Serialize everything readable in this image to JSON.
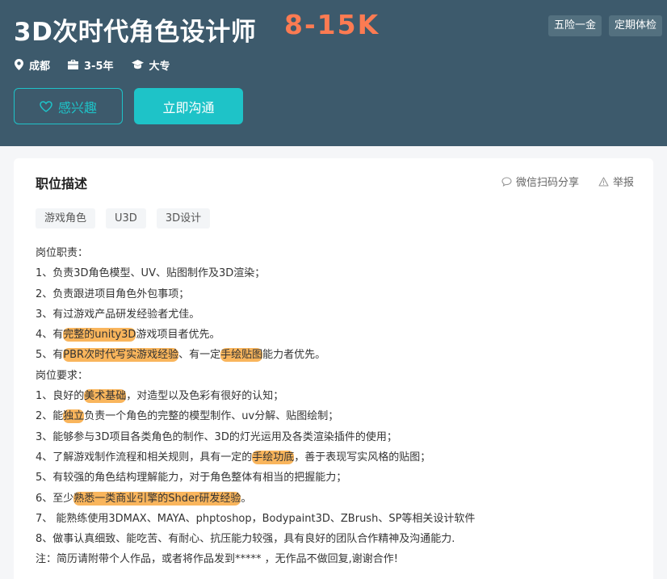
{
  "job": {
    "title": "3D次时代角色设计师",
    "salary": "8-15K",
    "benefits": [
      "五险一金",
      "定期体检"
    ],
    "meta": {
      "city": "成都",
      "experience": "3-5年",
      "education": "大专"
    }
  },
  "actions": {
    "interest_label": "感兴趣",
    "chat_label": "立即沟通"
  },
  "description": {
    "section_title": "职位描述",
    "share_label": "微信扫码分享",
    "report_label": "举报",
    "tags": [
      "游戏角色",
      "U3D",
      "3D设计"
    ],
    "lines": [
      {
        "segments": [
          {
            "text": "岗位职责：",
            "hl": false
          }
        ]
      },
      {
        "segments": [
          {
            "text": "1、负责3D角色模型、UV、贴图制作及3D渲染；",
            "hl": false
          }
        ]
      },
      {
        "segments": [
          {
            "text": "2、负责跟进项目角色外包事项；",
            "hl": false
          }
        ]
      },
      {
        "segments": [
          {
            "text": "3、有过游戏产品研发经验者尤佳。",
            "hl": false
          }
        ]
      },
      {
        "segments": [
          {
            "text": "4、有",
            "hl": false
          },
          {
            "text": "完整的unity3D",
            "hl": true
          },
          {
            "text": "游戏项目者优先。",
            "hl": false
          }
        ]
      },
      {
        "segments": [
          {
            "text": "5、有",
            "hl": false
          },
          {
            "text": "PBR次时代写实游戏经验",
            "hl": true
          },
          {
            "text": "、有一定",
            "hl": false
          },
          {
            "text": "手绘贴图",
            "hl": true
          },
          {
            "text": "能力者优先。",
            "hl": false
          }
        ]
      },
      {
        "segments": [
          {
            "text": "岗位要求：",
            "hl": false
          }
        ]
      },
      {
        "segments": [
          {
            "text": "1、良好的",
            "hl": false
          },
          {
            "text": "美术基础",
            "hl": true
          },
          {
            "text": "，对造型以及色彩有很好的认知；",
            "hl": false
          }
        ]
      },
      {
        "segments": [
          {
            "text": "2、能",
            "hl": false
          },
          {
            "text": "独立",
            "hl": true
          },
          {
            "text": "负责一个角色的完整的模型制作、uv分解、贴图绘制；",
            "hl": false
          }
        ]
      },
      {
        "segments": [
          {
            "text": "3、能够参与3D项目各类角色的制作、3D的灯光运用及各类渲染插件的使用；",
            "hl": false
          }
        ]
      },
      {
        "segments": [
          {
            "text": "4、了解游戏制作流程和相关规则，具有一定的",
            "hl": false
          },
          {
            "text": "手绘功底",
            "hl": true
          },
          {
            "text": "，善于表现写实风格的贴图；",
            "hl": false
          }
        ]
      },
      {
        "segments": [
          {
            "text": "5、有较强的角色结构理解能力，对于角色整体有相当的把握能力；",
            "hl": false
          }
        ]
      },
      {
        "segments": [
          {
            "text": "6、至少",
            "hl": false
          },
          {
            "text": "熟悉一类商业引擎的Shder研发经验",
            "hl": true
          },
          {
            "text": "。",
            "hl": false
          }
        ]
      },
      {
        "segments": [
          {
            "text": "7、 能熟练使用3DMAX、MAYA、phptoshop，Bodypaint3D、ZBrush、SP等相关设计软件",
            "hl": false
          }
        ]
      },
      {
        "segments": [
          {
            "text": "8、做事认真细致、能吃苦、有耐心、抗压能力较强，具有良好的团队合作精神及沟通能力.",
            "hl": false
          }
        ]
      },
      {
        "segments": [
          {
            "text": "注：简历请附带个人作品，或者将作品发到***** ，无作品不做回复,谢谢合作!",
            "hl": false
          }
        ]
      }
    ]
  },
  "colors": {
    "header_bg": "#3d5a6c",
    "salary": "#fc7b52",
    "accent": "#1ec3c8",
    "highlight": "#f9b55c"
  }
}
